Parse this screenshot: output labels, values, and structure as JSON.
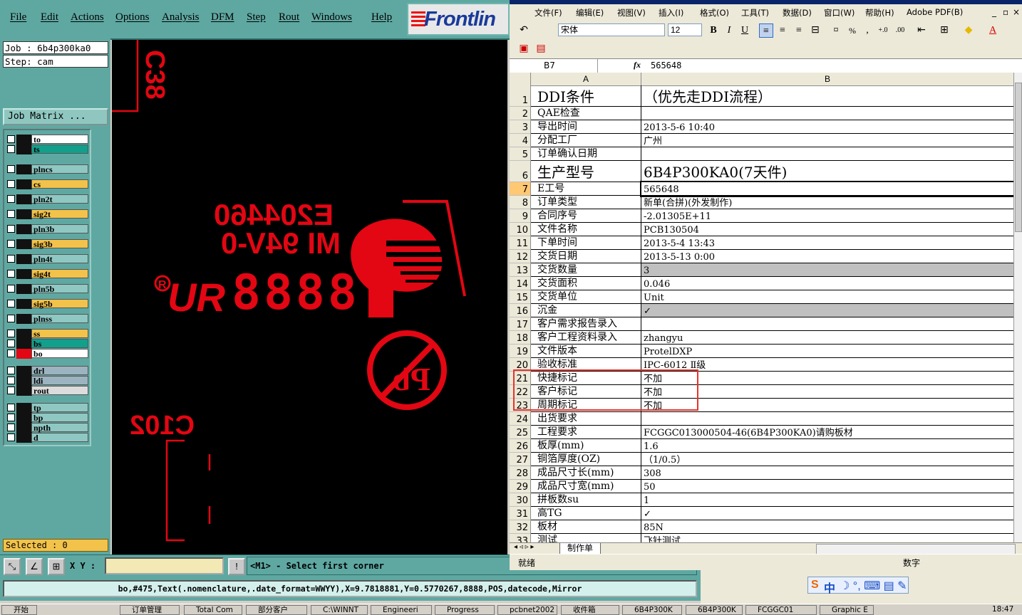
{
  "genesis": {
    "menu": [
      "File",
      "Edit",
      "Actions",
      "Options",
      "Analysis",
      "DFM",
      "Step",
      "Rout",
      "Windows",
      "Help"
    ],
    "logo_text": "Frontlin",
    "job": "Job : 6b4p300ka0",
    "step": "Step: cam",
    "job_matrix_button": "Job Matrix ...",
    "layers": [
      {
        "name": "to",
        "color": "#ffffff"
      },
      {
        "name": "ts",
        "color": "#12a08c"
      },
      {
        "name": "plncs",
        "color": "#8fc8c3"
      },
      {
        "name": "cs",
        "color": "#f2c24a"
      },
      {
        "name": "pln2t",
        "color": "#8fc8c3"
      },
      {
        "name": "sig2t",
        "color": "#f2c24a"
      },
      {
        "name": "pln3b",
        "color": "#8fc8c3"
      },
      {
        "name": "sig3b",
        "color": "#f2c24a"
      },
      {
        "name": "pln4t",
        "color": "#8fc8c3"
      },
      {
        "name": "sig4t",
        "color": "#f2c24a"
      },
      {
        "name": "pln5b",
        "color": "#8fc8c3"
      },
      {
        "name": "sig5b",
        "color": "#f2c24a"
      },
      {
        "name": "plnss",
        "color": "#8fc8c3"
      },
      {
        "name": "ss",
        "color": "#f2c24a"
      },
      {
        "name": "bs",
        "color": "#12a08c"
      },
      {
        "name": "bo",
        "color": "#ffffff"
      },
      {
        "name": "drl",
        "color": "#9cb4c0"
      },
      {
        "name": "ldi",
        "color": "#9cb4c0"
      },
      {
        "name": "rout",
        "color": "#dcdcdc"
      },
      {
        "name": "tp",
        "color": "#8fc8c3"
      },
      {
        "name": "bp",
        "color": "#8fc8c3"
      },
      {
        "name": "npth",
        "color": "#8fc8c3"
      },
      {
        "name": "d",
        "color": "#8fc8c3"
      }
    ],
    "selected": "Selected : 0",
    "xy_label": "X Y :",
    "hint": "<M1> - Select first corner",
    "status_line": "bo,#475,Text(.nomenclature,.date_format=WWYY),X=9.7818881,Y=0.5770267,8888,POS,datecode,Mirror",
    "canvas": {
      "ref1": "C38",
      "ref2": "C102",
      "ul_number": "E204460",
      "ul_rating": "MI 94V-0",
      "datecode": "8888",
      "logo_ur": "UR",
      "pb": "Pb",
      "registered": "R"
    },
    "colors": {
      "accent": "#5fa8a2",
      "silk": "#e30613"
    }
  },
  "excel": {
    "menu": [
      "文件(F)",
      "编辑(E)",
      "视图(V)",
      "插入(I)",
      "格式(O)",
      "工具(T)",
      "数据(D)",
      "窗口(W)",
      "帮助(H)",
      "Adobe PDF(B)"
    ],
    "font": "宋体",
    "font_size": "12",
    "name_box": "B7",
    "formula": "565648",
    "col_a": "A",
    "col_b": "B",
    "rows": [
      {
        "n": "1",
        "a": "DDI条件",
        "b": "（优先走DDI流程）",
        "big": true
      },
      {
        "n": "2",
        "a": "QAE检查",
        "b": ""
      },
      {
        "n": "3",
        "a": "导出时间",
        "b": "2013-5-6 10:40"
      },
      {
        "n": "4",
        "a": "分配工厂",
        "b": "广州"
      },
      {
        "n": "5",
        "a": "订单确认日期",
        "b": ""
      },
      {
        "n": "6",
        "a": "生产型号",
        "b": "6B4P300KA0(7天件)",
        "big": true
      },
      {
        "n": "7",
        "a": "E工号",
        "b": "565648"
      },
      {
        "n": "8",
        "a": "订单类型",
        "b": "新单(合拼)(外发制作)"
      },
      {
        "n": "9",
        "a": "合同序号",
        "b": "-2.01305E+11"
      },
      {
        "n": "10",
        "a": "文件名称",
        "b": "PCB130504"
      },
      {
        "n": "11",
        "a": "下单时间",
        "b": "2013-5-4 13:43"
      },
      {
        "n": "12",
        "a": "交货日期",
        "b": "2013-5-13 0:00"
      },
      {
        "n": "13",
        "a": "交货数量",
        "b": "3",
        "gray": true
      },
      {
        "n": "14",
        "a": "交货面积",
        "b": "0.046"
      },
      {
        "n": "15",
        "a": "交货单位",
        "b": "Unit"
      },
      {
        "n": "16",
        "a": "沉金",
        "b": "✓",
        "gray": true
      },
      {
        "n": "17",
        "a": "客户需求报告录入",
        "b": ""
      },
      {
        "n": "18",
        "a": "客户工程资料录入",
        "b": "zhangyu"
      },
      {
        "n": "19",
        "a": "文件版本",
        "b": "ProtelDXP"
      },
      {
        "n": "20",
        "a": "验收标准",
        "b": "IPC-6012 Ⅱ级"
      },
      {
        "n": "21",
        "a": "快捷标记",
        "b": "不加"
      },
      {
        "n": "22",
        "a": "客户标记",
        "b": "不加"
      },
      {
        "n": "23",
        "a": "周期标记",
        "b": "不加"
      },
      {
        "n": "24",
        "a": "出货要求",
        "b": ""
      },
      {
        "n": "25",
        "a": "工程要求",
        "b": "FCGGC013000504-46(6B4P300KA0)请购板材"
      },
      {
        "n": "26",
        "a": "板厚(mm)",
        "b": "1.6"
      },
      {
        "n": "27",
        "a": "铜箔厚度(OZ)",
        "b": "（1/0.5）"
      },
      {
        "n": "28",
        "a": "成品尺寸长(mm)",
        "b": "308"
      },
      {
        "n": "29",
        "a": "成品尺寸宽(mm)",
        "b": "50"
      },
      {
        "n": "30",
        "a": "拼板数su",
        "b": "1"
      },
      {
        "n": "31",
        "a": "高TG",
        "b": "✓"
      },
      {
        "n": "32",
        "a": "板材",
        "b": "85N"
      },
      {
        "n": "33",
        "a": "测试",
        "b": "飞针测试"
      }
    ],
    "sheet_tab": "制作单",
    "status_ready": "就绪",
    "status_num": "数字",
    "ime": "中"
  },
  "taskbar": [
    "开始",
    "订单管理",
    "Total Com",
    "部分客户",
    "C:\\WINNT",
    "Engineeri",
    "Progress",
    "pcbnet2002",
    "收件箱",
    "6B4P300K",
    "6B4P300K",
    "FCGGC01",
    "Graphic E"
  ],
  "clock": "18:47"
}
